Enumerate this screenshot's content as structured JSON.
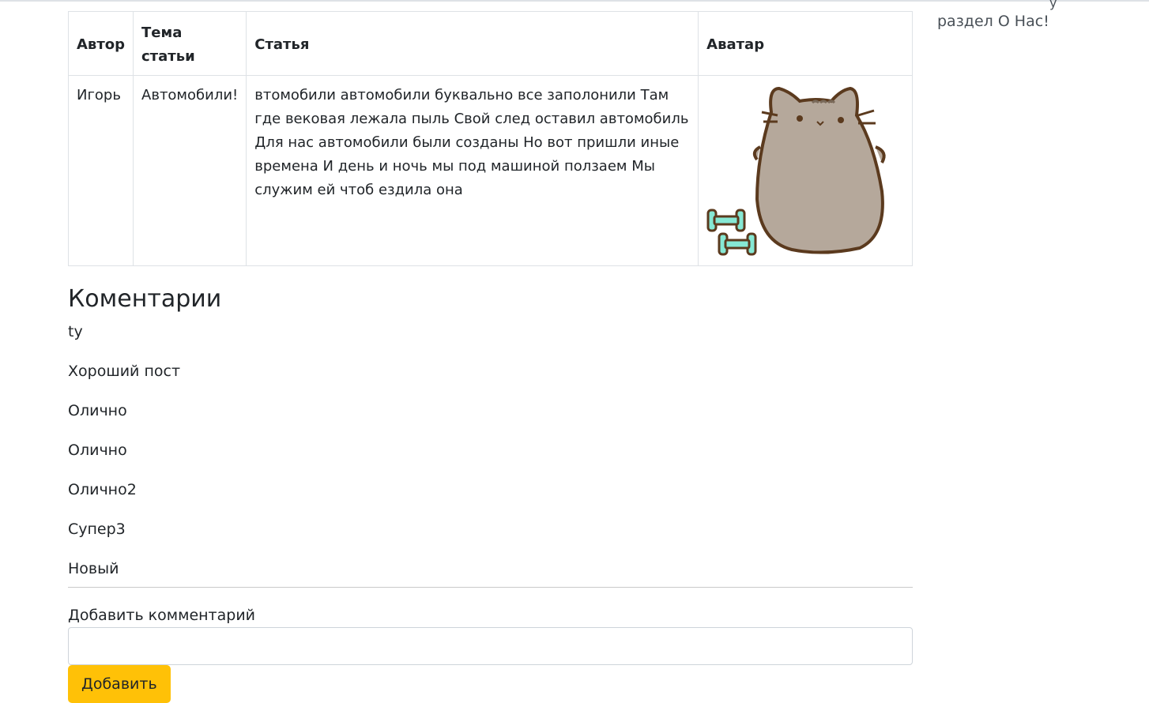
{
  "table": {
    "headers": {
      "author": "Автор",
      "topic": "Тема статьи",
      "article": "Статья",
      "avatar": "Аватар"
    },
    "row": {
      "author": "Игорь",
      "topic": "Автомобили!",
      "article": "втомобили автомобили буквально все заполонили Там где вековая лежала пыль Свой след оставил автомобиль Для нас автомобили были созданы Но вот пришли иные времена И день и ночь мы под машиной ползаем Мы служим ей чтоб ездила она"
    }
  },
  "comments": {
    "title": "Коментарии",
    "items": [
      "ty",
      "Хороший пост",
      "Олично",
      "Олично",
      "Олично2",
      "Супер3",
      "Новый"
    ]
  },
  "form": {
    "label": "Добавить комментарий",
    "input_value": "",
    "submit_label": "Добавить"
  },
  "sidebar": {
    "link_text": "раздел О Нас!",
    "cut_text": "у"
  },
  "colors": {
    "button": "#ffc107",
    "cat_body": "#b5a89b",
    "cat_outline": "#5b3a1e",
    "dumbbell": "#86e8d4"
  }
}
